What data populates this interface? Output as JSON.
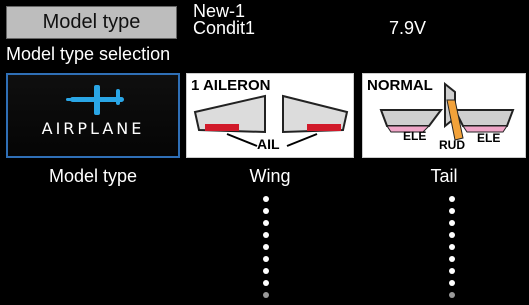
{
  "header": {
    "title": "Model type",
    "model_name": "New-1",
    "condition_name": "Condit1",
    "voltage": "7.9V"
  },
  "subtitle": "Model type selection",
  "tiles": {
    "model_type": {
      "label": "AIRPLANE",
      "icon": "airplane-icon",
      "caption": "Model type"
    },
    "wing": {
      "title": "1 AILERON",
      "label": "AIL",
      "caption": "Wing"
    },
    "tail": {
      "title": "NORMAL",
      "ele_left": "ELE",
      "rud": "RUD",
      "ele_right": "ELE",
      "caption": "Tail"
    }
  },
  "colors": {
    "highlight_border": "#2f6fb6",
    "airplane_icon": "#2aa6e6",
    "aileron_red": "#d11a2a",
    "rudder_orange": "#f2a23a",
    "elevator_pink": "#f0a6c8"
  }
}
